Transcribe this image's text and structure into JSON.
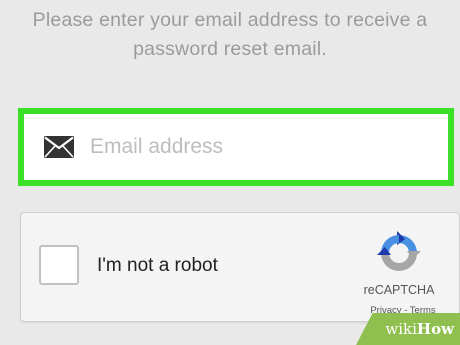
{
  "instructions": {
    "line1": "Please enter your email address to receive a",
    "line2": "password reset email."
  },
  "email_field": {
    "placeholder": "Email address",
    "value": "",
    "icon": "envelope-icon",
    "highlight_color": "#3be126"
  },
  "recaptcha": {
    "checkbox_label": "I'm not a robot",
    "brand": "reCAPTCHA",
    "privacy": "Privacy",
    "separator": " - ",
    "terms": "Terms",
    "checked": false,
    "icon": "recaptcha-logo-icon"
  },
  "watermark": {
    "part1": "wiki",
    "part2": "How",
    "color": "#8fbf4e"
  }
}
